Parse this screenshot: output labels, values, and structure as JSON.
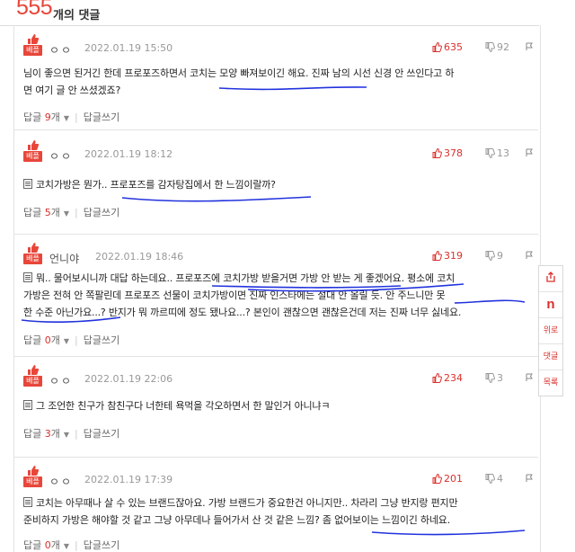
{
  "header": {
    "count": "555",
    "count_label": "개의 댓글"
  },
  "badge_label": "베플",
  "reply_label": "답글",
  "reply_unit": "개",
  "write_reply": "답글쓰기",
  "sidebar": [
    {
      "name": "share",
      "label": ""
    },
    {
      "name": "naver",
      "label": "n"
    },
    {
      "name": "top",
      "label": "위로"
    },
    {
      "name": "comments",
      "label": "댓글"
    },
    {
      "name": "list",
      "label": "목록"
    }
  ],
  "comments": [
    {
      "nick": "ㅇㅇ",
      "date": "2022.01.19 15:50",
      "up": "635",
      "down": "92",
      "lines": [
        "님이 좋으면 된거긴 한데 프로포즈하면서 코치는 모양 빠져보이긴 해요. 진짜 남의 시선 신경 안 쓰인다고 하",
        "면 여기 글 안 쓰셨겠죠?"
      ],
      "replies": "9",
      "doc": false
    },
    {
      "nick": "ㅇㅇ",
      "date": "2022.01.19 18:12",
      "up": "378",
      "down": "13",
      "lines": [
        "코치가방은 뭔가.. 프로포즈를 감자탕집에서 한 느낌이랄까?"
      ],
      "replies": "5",
      "doc": true
    },
    {
      "nick": "언니야",
      "date": "2022.01.19 18:46",
      "up": "319",
      "down": "9",
      "lines": [
        "뭐.. 물어보시니까 대답 하는데요.. 프로포즈에 코치가방 받을거면 가방 안 받는 게 좋겠어요. 평소에 코치",
        "가방은 전혀 안 쪽팔린데 프로포즈 선물이 코치가방이면 진짜 인스타에는 절대 안 올릴 듯. 안 주느니만 못",
        "한 수준 아닌가요...? 반지가 뭐 까르띠에 정도 됐나요...? 본인이 괜찮으면 괜찮은건데 저는 진짜 너무 싫네요."
      ],
      "replies": "0",
      "doc": true
    },
    {
      "nick": "ㅇㅇ",
      "date": "2022.01.19 22:06",
      "up": "234",
      "down": "3",
      "lines": [
        "그 조언한 친구가 참친구다 너한테 욕먹을 각오하면서 한 말인거 아니냐ㅋ"
      ],
      "replies": "3",
      "doc": true
    },
    {
      "nick": "ㅇㅇ",
      "date": "2022.01.19 17:39",
      "up": "201",
      "down": "4",
      "lines": [
        "코치는 아무때나 살 수 있는 브랜드잖아요. 가방 브랜드가 중요한건 아니지만.. 차라리 그냥 반지랑 편지만",
        "준비하지 가방은 해야할 것 같고 그냥 아무데나 들어가서 산 것 같은 느낌? 좀 없어보이는 느낌이긴 하네요."
      ],
      "replies": "0",
      "doc": true
    }
  ]
}
